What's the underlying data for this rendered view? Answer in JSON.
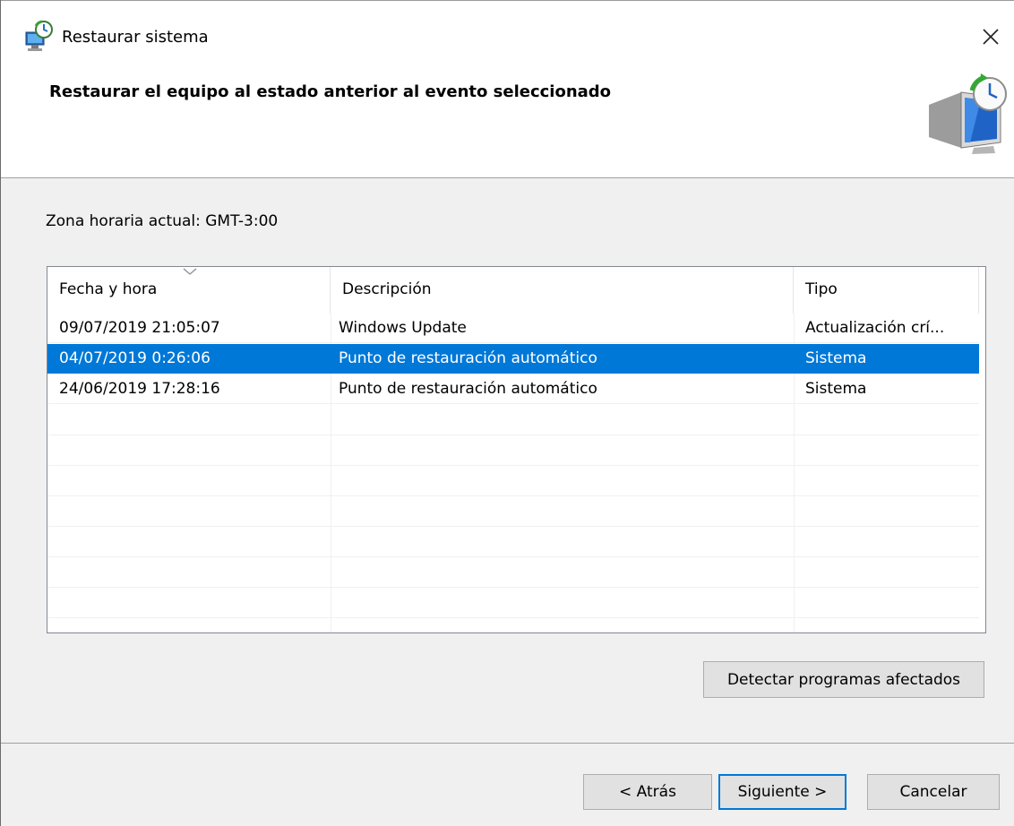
{
  "window": {
    "title": "Restaurar sistema",
    "close_label": "✕"
  },
  "header": {
    "heading": "Restaurar el equipo al estado anterior al evento seleccionado",
    "graphic_icon": "system-restore-monitor-icon"
  },
  "timezone": {
    "text": "Zona horaria actual: GMT-3:00"
  },
  "table": {
    "columns": [
      "Fecha y hora",
      "Descripción",
      "Tipo"
    ],
    "sort_column": "Fecha y hora",
    "rows": [
      {
        "date": "09/07/2019 21:05:07",
        "description": "Windows Update",
        "type": "Actualización crí...",
        "selected": false
      },
      {
        "date": "04/07/2019 0:26:06",
        "description": "Punto de restauración automático",
        "type": "Sistema",
        "selected": true
      },
      {
        "date": "24/06/2019 17:28:16",
        "description": "Punto de restauración automático",
        "type": "Sistema",
        "selected": false
      }
    ]
  },
  "buttons": {
    "detect": "Detectar programas afectados",
    "back": "< Atrás",
    "next": "Siguiente >",
    "cancel": "Cancelar"
  },
  "colors": {
    "selection": "#0078d7",
    "default_button_border": "#0078d7",
    "button_face": "#e1e1e1",
    "dialog_bg": "#f0f0f0"
  }
}
